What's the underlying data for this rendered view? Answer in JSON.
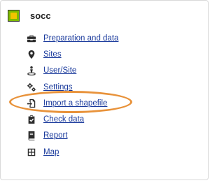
{
  "panel": {
    "title": "socc"
  },
  "menu": {
    "items": [
      {
        "label": "Preparation and data",
        "icon": "toolbox-icon"
      },
      {
        "label": "Sites",
        "icon": "map-marker-icon"
      },
      {
        "label": "User/Site",
        "icon": "person-pin-icon"
      },
      {
        "label": "Settings",
        "icon": "gears-icon"
      },
      {
        "label": "Import a shapefile",
        "icon": "file-import-icon"
      },
      {
        "label": "Check data",
        "icon": "clipboard-check-icon"
      },
      {
        "label": "Report",
        "icon": "book-icon"
      },
      {
        "label": "Map",
        "icon": "grid-map-icon"
      }
    ]
  },
  "annotation": {
    "highlight_color": "#e8923a",
    "highlighted_item": "Import a shapefile"
  },
  "colors": {
    "link": "#1a3a9c",
    "logo_outer": "#7dbb00",
    "logo_inner": "#f2c400"
  }
}
